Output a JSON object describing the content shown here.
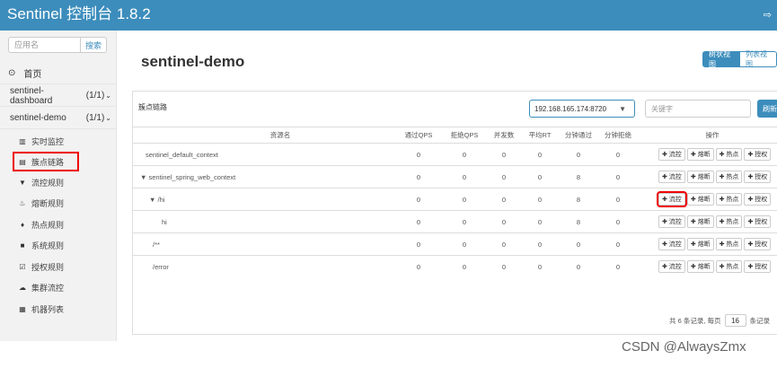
{
  "app": {
    "title": "Sentinel 控制台 1.8.2",
    "exit_icon": "exit-icon"
  },
  "sidebar": {
    "search_placeholder": "应用名",
    "search_button": "搜索",
    "home_label": "首页",
    "apps": [
      {
        "name": "sentinel-dashboard",
        "count": "(1/1)"
      },
      {
        "name": "sentinel-demo",
        "count": "(1/1)"
      }
    ],
    "menu": [
      {
        "label": "实时监控",
        "icon": "bar-chart-icon"
      },
      {
        "label": "簇点链路",
        "icon": "list-icon",
        "active": true
      },
      {
        "label": "流控规则",
        "icon": "filter-icon"
      },
      {
        "label": "熔断规则",
        "icon": "fire-icon"
      },
      {
        "label": "热点规则",
        "icon": "flame-icon"
      },
      {
        "label": "系统规则",
        "icon": "lock-icon"
      },
      {
        "label": "授权规则",
        "icon": "check-icon"
      },
      {
        "label": "集群流控",
        "icon": "cloud-icon"
      },
      {
        "label": "机器列表",
        "icon": "grid-icon"
      }
    ]
  },
  "main": {
    "title": "sentinel-demo",
    "view_tree": "树状视图",
    "view_list": "列表视图",
    "panel_title": "簇点链路",
    "machine": "192.168.165.174:8720",
    "keyword_placeholder": "关键字",
    "refresh": "刷新",
    "columns": [
      "资源名",
      "通过QPS",
      "拒绝QPS",
      "并发数",
      "平均RT",
      "分钟通过",
      "分钟拒绝",
      "操作"
    ],
    "rows": [
      {
        "name": "sentinel_default_context",
        "prefix": "",
        "v": [
          "0",
          "0",
          "0",
          "0",
          "0",
          "0"
        ]
      },
      {
        "name": "sentinel_spring_web_context",
        "prefix": "▼ ",
        "v": [
          "0",
          "0",
          "0",
          "0",
          "8",
          "0"
        ]
      },
      {
        "name": "/hi",
        "prefix": "▼ ",
        "v": [
          "0",
          "0",
          "0",
          "0",
          "8",
          "0"
        ]
      },
      {
        "name": "hi",
        "prefix": "",
        "v": [
          "0",
          "0",
          "0",
          "0",
          "8",
          "0"
        ]
      },
      {
        "name": "/**",
        "prefix": "",
        "v": [
          "0",
          "0",
          "0",
          "0",
          "0",
          "0"
        ]
      },
      {
        "name": "/error",
        "prefix": "",
        "v": [
          "0",
          "0",
          "0",
          "0",
          "0",
          "0"
        ]
      }
    ],
    "actions": [
      "✚ 流控",
      "✚ 熔断",
      "✚ 热点",
      "✚ 授权"
    ],
    "pager_prefix": "共 6 条记录, 每页",
    "page_size": "16",
    "pager_suffix": "条记录"
  },
  "watermark": "CSDN @AlwaysZmx"
}
